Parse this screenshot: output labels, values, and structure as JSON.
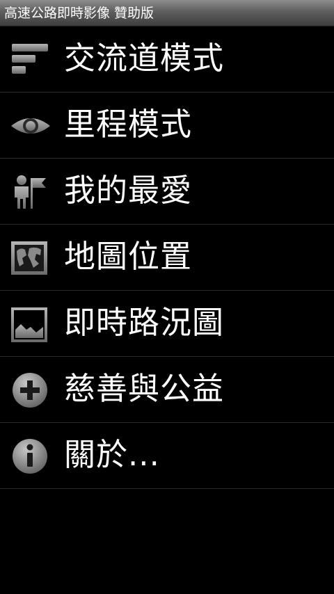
{
  "app": {
    "title": "高速公路即時影像 贊助版"
  },
  "menu": {
    "items": [
      {
        "label": "交流道模式",
        "icon": "interchange-list-icon"
      },
      {
        "label": "里程模式",
        "icon": "eye-icon"
      },
      {
        "label": "我的最愛",
        "icon": "person-flag-icon"
      },
      {
        "label": "地圖位置",
        "icon": "map-globe-icon"
      },
      {
        "label": "即時路況圖",
        "icon": "picture-landscape-icon"
      },
      {
        "label": "慈善與公益",
        "icon": "plus-circle-icon"
      },
      {
        "label": "關於...",
        "icon": "info-circle-icon"
      }
    ]
  },
  "colors": {
    "background": "#000000",
    "titlebar_top": "#8d8d8d",
    "titlebar_bottom": "#3e3e3e",
    "divider": "#2a2a2a",
    "icon_gray": "#9a9a9a",
    "text": "#ffffff"
  }
}
